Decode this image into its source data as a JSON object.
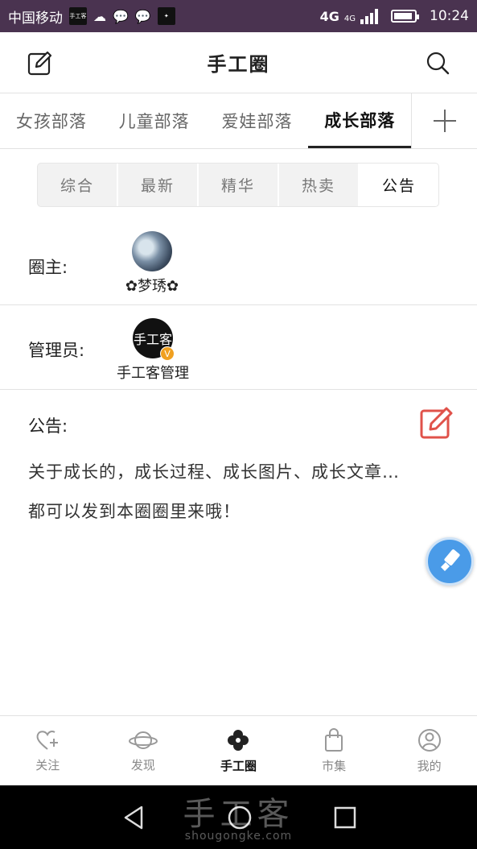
{
  "status_bar": {
    "carrier": "中国移动",
    "app_badge": "手工客",
    "network_left": "4G",
    "network_right": "4G",
    "time": "10:24"
  },
  "header": {
    "title": "手工圈"
  },
  "tribe_tabs": [
    {
      "label": "女孩部落",
      "active": false
    },
    {
      "label": "儿童部落",
      "active": false
    },
    {
      "label": "爱娃部落",
      "active": false
    },
    {
      "label": "成长部落",
      "active": true
    }
  ],
  "sub_tabs": [
    {
      "label": "综合",
      "active": false
    },
    {
      "label": "最新",
      "active": false
    },
    {
      "label": "精华",
      "active": false
    },
    {
      "label": "热卖",
      "active": false
    },
    {
      "label": "公告",
      "active": true
    }
  ],
  "owner": {
    "label": "圈主:",
    "name": "✿梦琇✿"
  },
  "admin": {
    "label": "管理员:",
    "avatar_text": "手工客",
    "badge": "V",
    "name": "手工客管理"
  },
  "notice": {
    "label": "公告:",
    "line1": "关于成长的，成长过程、成长图片、成长文章…",
    "line2": "都可以发到本圈圈里来哦！"
  },
  "bottom_nav": [
    {
      "label": "关注",
      "icon": "heart-plus-icon",
      "active": false
    },
    {
      "label": "发现",
      "icon": "planet-icon",
      "active": false
    },
    {
      "label": "手工圈",
      "icon": "pinwheel-icon",
      "active": true
    },
    {
      "label": "市集",
      "icon": "shopping-bag-icon",
      "active": false
    },
    {
      "label": "我的",
      "icon": "user-icon",
      "active": false
    }
  ],
  "watermark": {
    "brand": "手工客",
    "url": "shougongke.com"
  },
  "colors": {
    "status_bar": "#4a3350",
    "accent_red": "#e0524a",
    "fab_blue": "#4a9be8"
  }
}
